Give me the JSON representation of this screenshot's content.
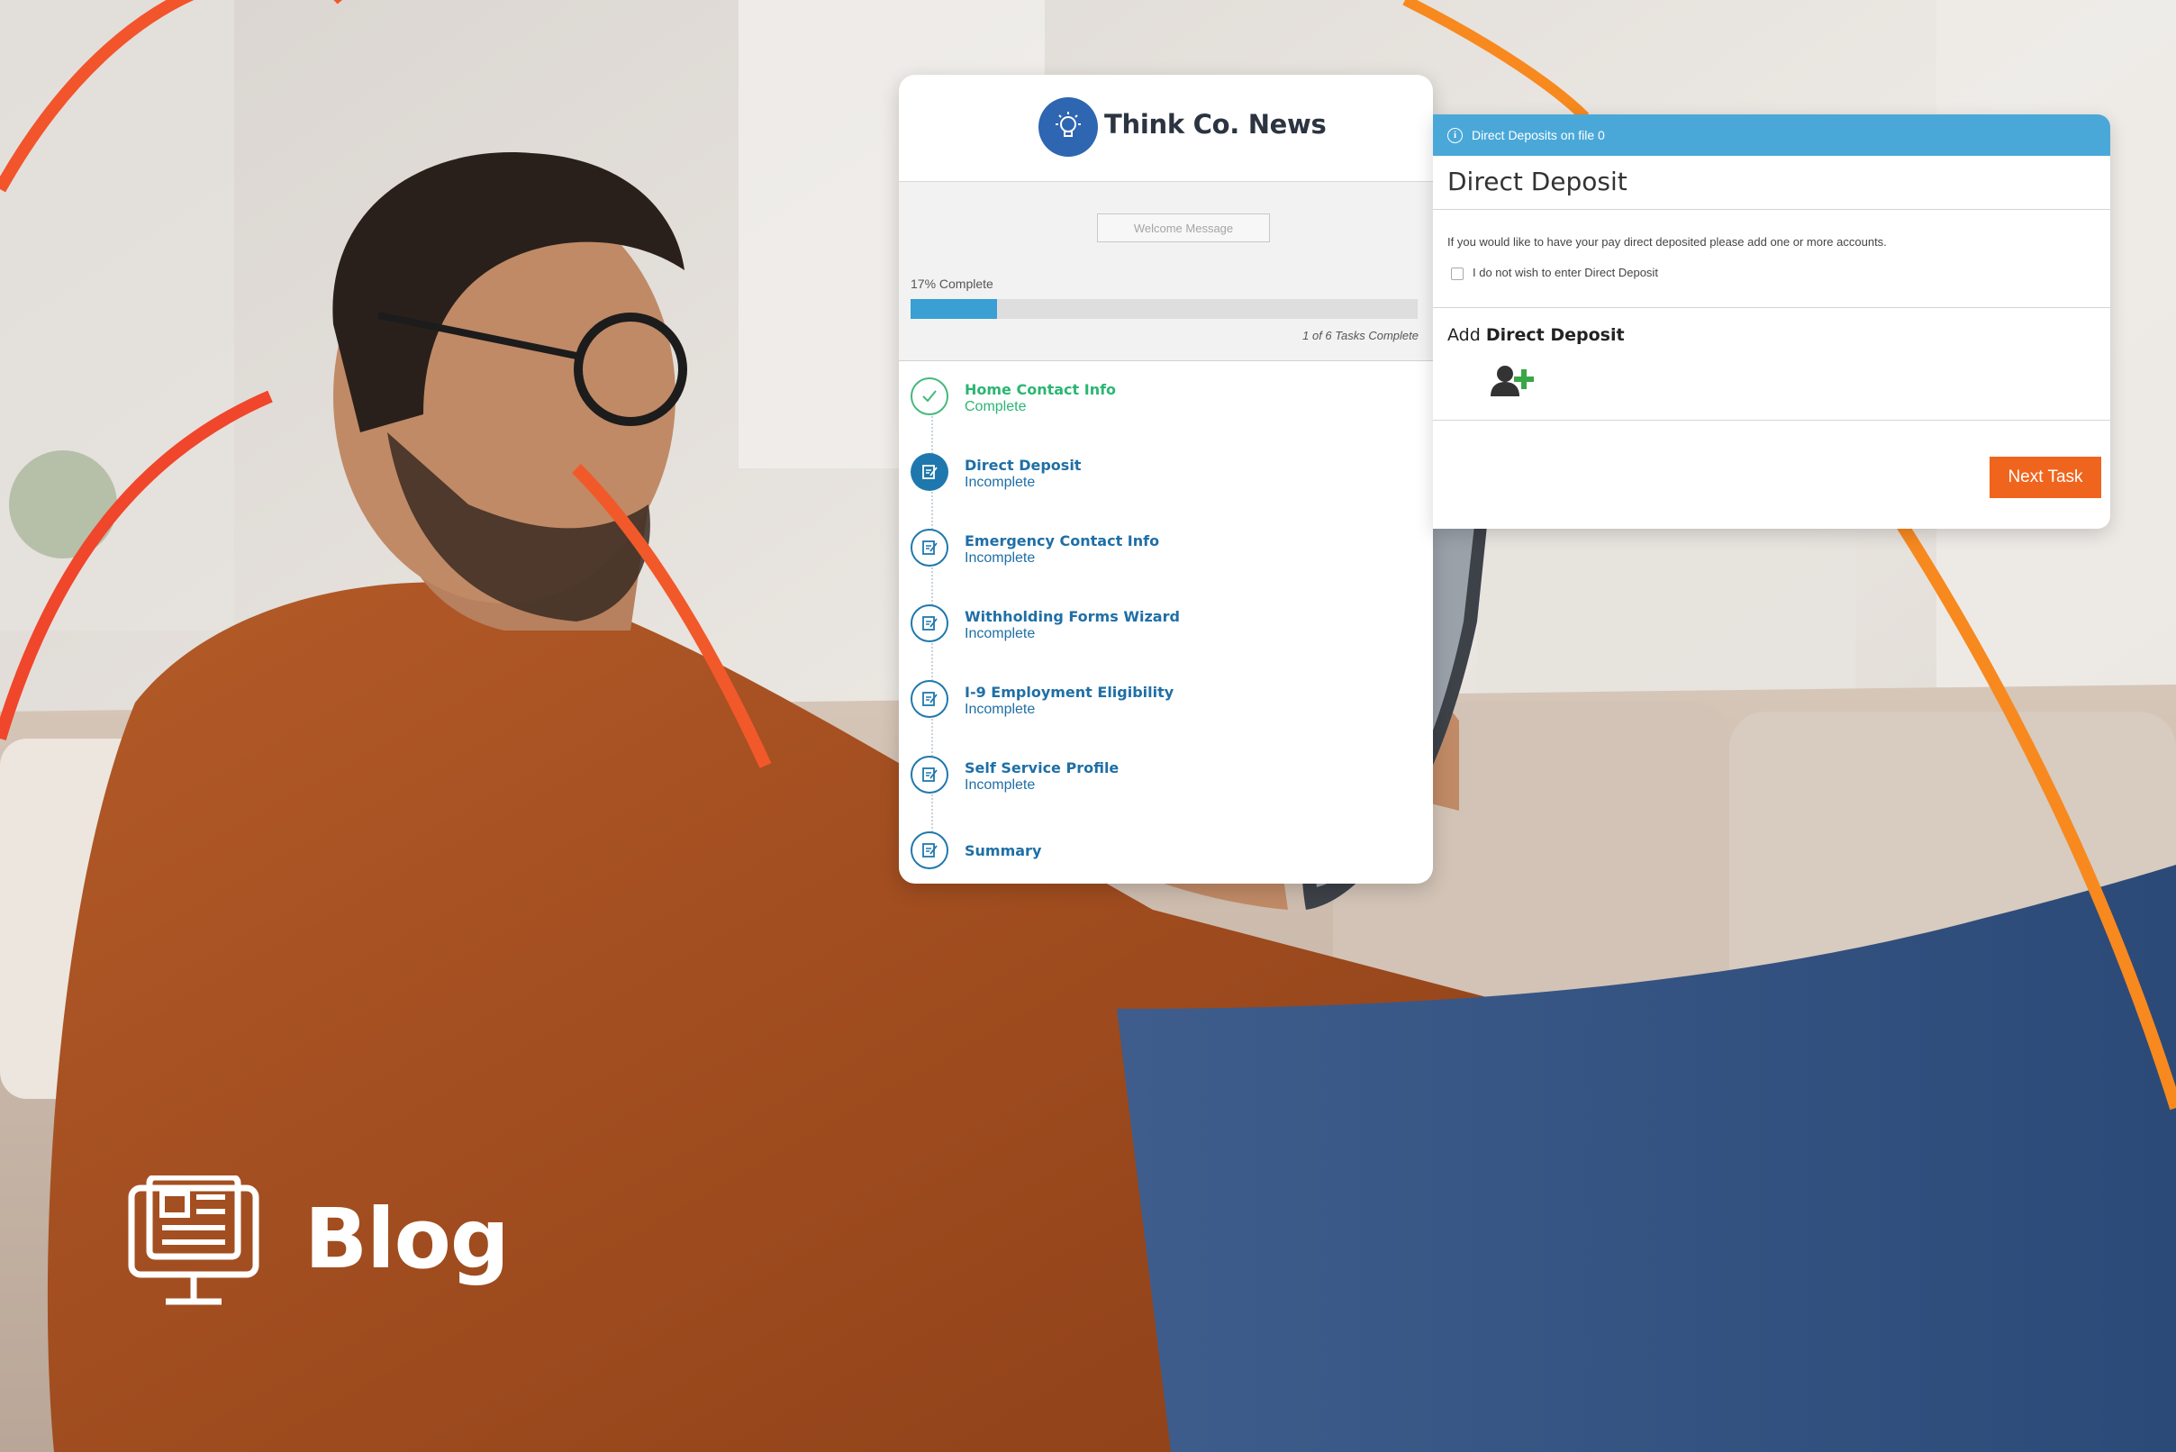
{
  "brand": {
    "name": "Think Co. News",
    "logo_icon": "lightbulb-icon",
    "logo_color": "#2e66b1"
  },
  "welcome_button": "Welcome Message",
  "progress": {
    "percent": 17,
    "label": "17% Complete",
    "tasks_text": "1 of 6 Tasks Complete",
    "fill_color": "#3a9fd3"
  },
  "steps": [
    {
      "title": "Home Contact Info",
      "status": "Complete",
      "state": "done"
    },
    {
      "title": "Direct Deposit",
      "status": "Incomplete",
      "state": "current"
    },
    {
      "title": "Emergency Contact Info",
      "status": "Incomplete",
      "state": "todo"
    },
    {
      "title": "Withholding Forms Wizard",
      "status": "Incomplete",
      "state": "todo"
    },
    {
      "title": "I-9 Employment Eligibility",
      "status": "Incomplete",
      "state": "todo"
    },
    {
      "title": "Self Service Profile",
      "status": "Incomplete",
      "state": "todo"
    },
    {
      "title": "Summary",
      "status": "",
      "state": "todo"
    }
  ],
  "direct_deposit": {
    "banner": "Direct Deposits on file 0",
    "title": "Direct Deposit",
    "instructions": "If you would like to have your pay direct deposited please add one or more accounts.",
    "opt_out_label": "I do not wish to enter Direct Deposit",
    "add_label_prefix": "Add",
    "add_label_bold": "Direct Deposit",
    "add_icon": "add-user-icon",
    "next_button": "Next Task",
    "banner_color": "#4aa8d8",
    "button_color": "#f0651d"
  },
  "blog": {
    "label": "Blog",
    "icon": "monitor-news-icon"
  },
  "colors": {
    "done_green": "#2bb673",
    "step_blue": "#1f6fa6",
    "arc_orange": "#f7891f",
    "arc_red": "#f0462b"
  }
}
